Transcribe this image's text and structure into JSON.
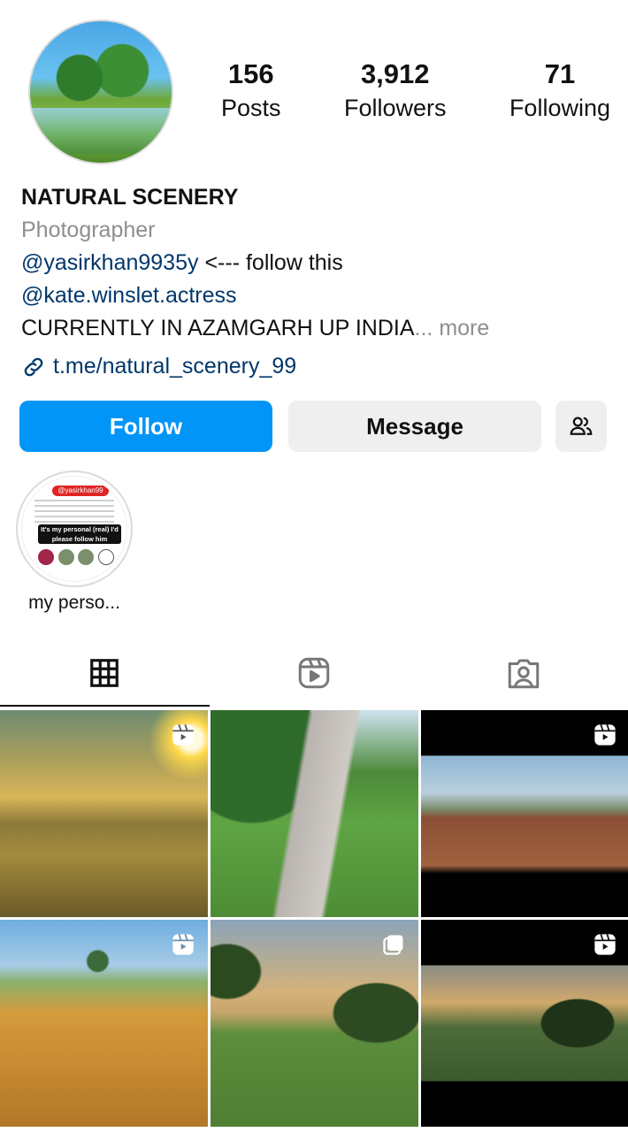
{
  "profile": {
    "stats": [
      {
        "value": "156",
        "label": "Posts"
      },
      {
        "value": "3,912",
        "label": "Followers"
      },
      {
        "value": "71",
        "label": "Following"
      }
    ],
    "name": "NATURAL SCENERY",
    "category": "Photographer",
    "bio_mention_1": "@yasirkhan9935y",
    "bio_text_1": " <--- follow this",
    "bio_mention_2": "@kate.winslet.actress",
    "bio_text_2": "CURRENTLY IN AZAMGARH UP INDIA",
    "bio_more": "... more",
    "link": "t.me/natural_scenery_99"
  },
  "actions": {
    "follow": "Follow",
    "message": "Message"
  },
  "highlights": [
    {
      "label": "my perso...",
      "tag": "@yasirkhan99",
      "caption": "It's my personal (real) I'd please follow him"
    }
  ],
  "tabs": [
    {
      "icon": "grid-icon",
      "active": true
    },
    {
      "icon": "reels-icon",
      "active": false
    },
    {
      "icon": "tagged-icon",
      "active": false
    }
  ],
  "posts": [
    {
      "type": "reel",
      "subject": "golden wheat field at sunrise"
    },
    {
      "type": "photo",
      "subject": "paved park path with trees"
    },
    {
      "type": "reel",
      "subject": "ploughed field at dawn"
    },
    {
      "type": "reel",
      "subject": "harvested farm field with tree"
    },
    {
      "type": "carousel",
      "subject": "green field with palm tree at sunset"
    },
    {
      "type": "reel",
      "subject": "green field with trees at dusk"
    }
  ],
  "colors": {
    "follow_button": "#0095f6",
    "secondary_button": "#efefef",
    "link": "#00376b",
    "muted": "#8e8e8e"
  }
}
